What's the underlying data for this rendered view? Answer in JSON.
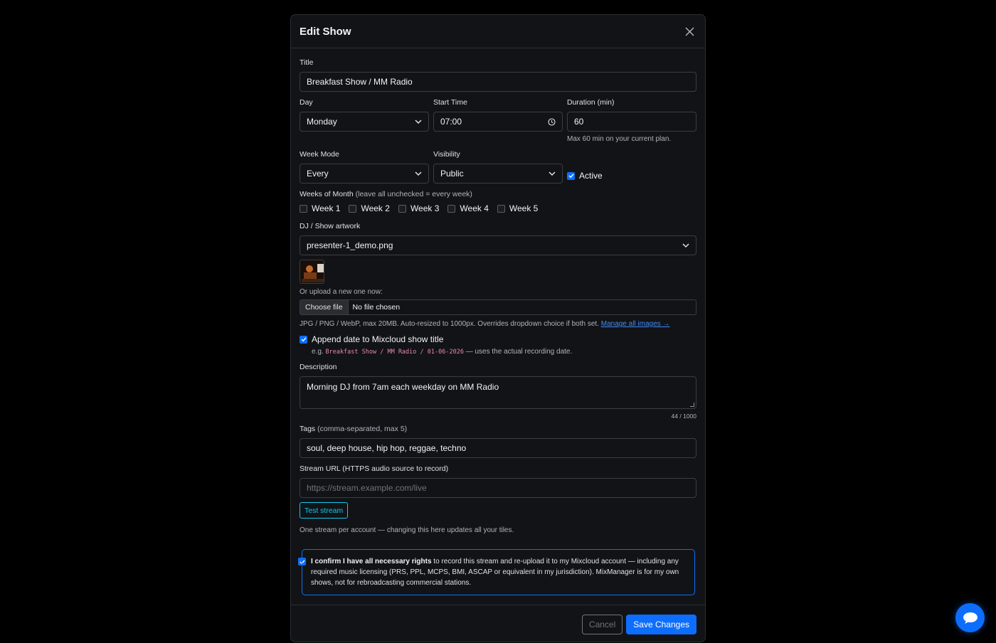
{
  "modal": {
    "title": "Edit Show",
    "title_field": {
      "label": "Title",
      "value": "Breakfast Show / MM Radio"
    },
    "day": {
      "label": "Day",
      "value": "Monday"
    },
    "start_time": {
      "label": "Start Time",
      "value": "07:00"
    },
    "duration": {
      "label": "Duration (min)",
      "value": "60",
      "help": "Max 60 min on your current plan."
    },
    "week_mode": {
      "label": "Week Mode",
      "value": "Every"
    },
    "visibility": {
      "label": "Visibility",
      "value": "Public"
    },
    "active": {
      "label": "Active",
      "checked": true
    },
    "weeks_of_month": {
      "label": "Weeks of Month",
      "hint": "(leave all unchecked = every week)",
      "weeks": [
        {
          "label": "Week 1",
          "checked": false
        },
        {
          "label": "Week 2",
          "checked": false
        },
        {
          "label": "Week 3",
          "checked": false
        },
        {
          "label": "Week 4",
          "checked": false
        },
        {
          "label": "Week 5",
          "checked": false
        }
      ]
    },
    "artwork": {
      "label": "DJ / Show artwork",
      "value": "presenter-1_demo.png",
      "upload_label": "Or upload a new one now:",
      "choose_file": "Choose file",
      "no_file": "No file chosen",
      "help": "JPG / PNG / WebP, max 20MB. Auto-resized to 1000px. Overrides dropdown choice if both set.",
      "manage_link": "Manage all images →"
    },
    "append_date": {
      "label": "Append date to Mixcloud show title",
      "checked": true,
      "example_prefix": "e.g.",
      "example_code": "Breakfast Show / MM Radio / 01-06-2026",
      "example_suffix": "— uses the actual recording date."
    },
    "description": {
      "label": "Description",
      "value": "Morning DJ from 7am each weekday on MM Radio",
      "counter": "44 / 1000"
    },
    "tags": {
      "label": "Tags",
      "hint": "(comma-separated, max 5)",
      "value": "soul, deep house, hip hop, reggae, techno"
    },
    "stream_url": {
      "label": "Stream URL (HTTPS audio source to record)",
      "placeholder": "https://stream.example.com/live",
      "test_button": "Test stream",
      "help": "One stream per account — changing this here updates all your tiles."
    },
    "confirm": {
      "checked": true,
      "bold": "I confirm I have all necessary rights",
      "text": " to record this stream and re-upload it to my Mixcloud account — including any required music licensing (PRS, PPL, MCPS, BMI, ASCAP or equivalent in my jurisdiction). MixManager is for my own shows, not for rebroadcasting commercial stations."
    },
    "footer": {
      "cancel": "Cancel",
      "save": "Save Changes"
    }
  },
  "colors": {
    "accent": "#0d6efd",
    "info": "#0dcaf0",
    "background": "#121316"
  },
  "icons": [
    "close-icon",
    "chevron-down-icon",
    "clock-icon",
    "check-icon",
    "chat-icon"
  ]
}
